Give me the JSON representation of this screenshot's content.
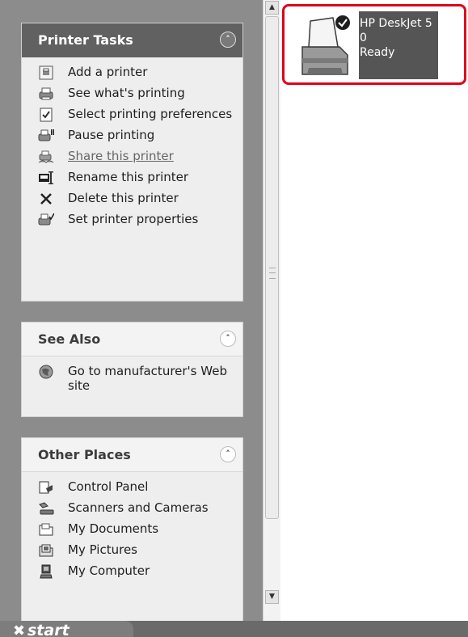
{
  "printer_tasks": {
    "title": "Printer Tasks",
    "items": [
      {
        "label": "Add a printer",
        "icon": "add-printer-icon"
      },
      {
        "label": "See what's printing",
        "icon": "print-queue-icon"
      },
      {
        "label": "Select printing preferences",
        "icon": "preferences-icon"
      },
      {
        "label": "Pause printing",
        "icon": "pause-printer-icon"
      },
      {
        "label": "Share this printer",
        "icon": "share-printer-icon"
      },
      {
        "label": "Rename this printer",
        "icon": "rename-icon"
      },
      {
        "label": "Delete this printer",
        "icon": "delete-icon"
      },
      {
        "label": "Set printer properties",
        "icon": "printer-properties-icon"
      }
    ]
  },
  "see_also": {
    "title": "See Also",
    "items": [
      {
        "label": "Go to manufacturer's Web site",
        "icon": "globe-icon"
      }
    ]
  },
  "other_places": {
    "title": "Other Places",
    "items": [
      {
        "label": "Control Panel",
        "icon": "control-panel-icon"
      },
      {
        "label": "Scanners and Cameras",
        "icon": "scanner-icon"
      },
      {
        "label": "My Documents",
        "icon": "folder-icon"
      },
      {
        "label": "My Pictures",
        "icon": "pictures-icon"
      },
      {
        "label": "My Computer",
        "icon": "computer-icon"
      }
    ]
  },
  "printer": {
    "name": "HP DeskJet 5",
    "jobs": "0",
    "status": "Ready"
  },
  "taskbar": {
    "start_label": "start"
  },
  "colors": {
    "highlight": "#e0001b",
    "selection": "#555555"
  }
}
